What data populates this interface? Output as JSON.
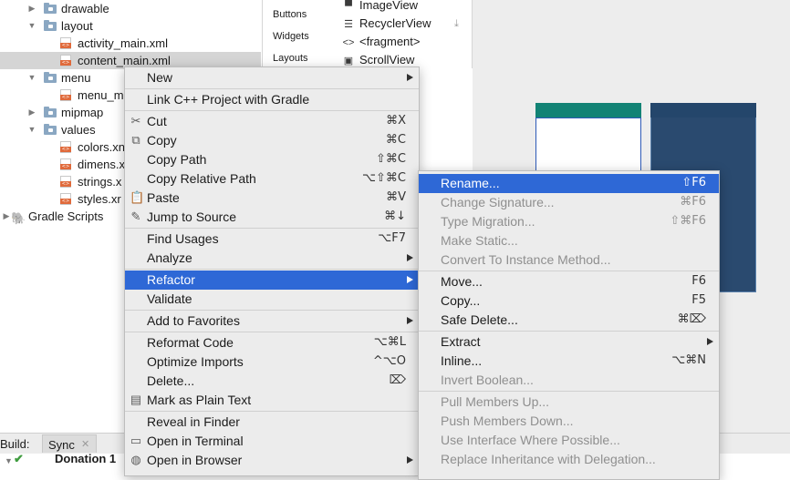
{
  "tree": {
    "items": [
      {
        "label": "drawable",
        "type": "folder",
        "expanded": false
      },
      {
        "label": "layout",
        "type": "folder",
        "expanded": true
      },
      {
        "label": "activity_main.xml",
        "type": "xml"
      },
      {
        "label": "content_main.xml",
        "type": "xml",
        "selected": true
      },
      {
        "label": "menu",
        "type": "folder",
        "expanded": true
      },
      {
        "label": "menu_m",
        "type": "xml"
      },
      {
        "label": "mipmap",
        "type": "folder",
        "expanded": false
      },
      {
        "label": "values",
        "type": "folder",
        "expanded": true
      },
      {
        "label": "colors.xn",
        "type": "xml"
      },
      {
        "label": "dimens.x",
        "type": "xml"
      },
      {
        "label": "strings.x",
        "type": "xml"
      },
      {
        "label": "styles.xr",
        "type": "xml"
      },
      {
        "label": "Gradle Scripts",
        "type": "gradle",
        "expanded": false
      }
    ]
  },
  "palette": {
    "categories": [
      "Buttons",
      "Widgets",
      "Layouts"
    ],
    "items": [
      {
        "label": "ImageView",
        "icon": "image-icon"
      },
      {
        "label": "RecyclerView",
        "icon": "list-icon"
      },
      {
        "label": "<fragment>",
        "icon": "code-icon"
      },
      {
        "label": "ScrollView",
        "icon": "scroll-icon"
      }
    ],
    "download_icon": "download-icon"
  },
  "build": {
    "label": "Build:",
    "tab": "Sync",
    "row_text": "Donation 1"
  },
  "context_menu": {
    "items": [
      {
        "label": "New",
        "submenu": true
      },
      {
        "sep": true
      },
      {
        "label": "Link C++ Project with Gradle"
      },
      {
        "sep": true
      },
      {
        "label": "Cut",
        "icon": "scissors-icon",
        "shortcut": "⌘X"
      },
      {
        "label": "Copy",
        "icon": "copy-icon",
        "shortcut": "⌘C"
      },
      {
        "label": "Copy Path",
        "shortcut": "⇧⌘C"
      },
      {
        "label": "Copy Relative Path",
        "shortcut": "⌥⇧⌘C"
      },
      {
        "label": "Paste",
        "icon": "paste-icon",
        "shortcut": "⌘V"
      },
      {
        "label": "Jump to Source",
        "icon": "pencil-icon",
        "shortcut": "⌘↓"
      },
      {
        "sep": true
      },
      {
        "label": "Find Usages",
        "shortcut": "⌥F7"
      },
      {
        "label": "Analyze",
        "submenu": true
      },
      {
        "sep": true
      },
      {
        "label": "Refactor",
        "submenu": true,
        "highlighted": true
      },
      {
        "label": "Validate"
      },
      {
        "sep": true
      },
      {
        "label": "Add to Favorites",
        "submenu": true
      },
      {
        "sep": true
      },
      {
        "label": "Reformat Code",
        "shortcut": "⌥⌘L"
      },
      {
        "label": "Optimize Imports",
        "shortcut": "^⌥O"
      },
      {
        "label": "Delete...",
        "shortcut": "⌦"
      },
      {
        "label": "Mark as Plain Text",
        "icon": "text-icon"
      },
      {
        "sep": true
      },
      {
        "label": "Reveal in Finder"
      },
      {
        "label": "Open in Terminal",
        "icon": "terminal-icon"
      },
      {
        "label": "Open in Browser",
        "icon": "globe-icon",
        "submenu": true
      }
    ]
  },
  "refactor_menu": {
    "items": [
      {
        "label": "Rename...",
        "shortcut": "⇧F6",
        "highlighted": true
      },
      {
        "label": "Change Signature...",
        "shortcut": "⌘F6",
        "disabled": true
      },
      {
        "label": "Type Migration...",
        "shortcut": "⇧⌘F6",
        "disabled": true
      },
      {
        "label": "Make Static...",
        "disabled": true
      },
      {
        "label": "Convert To Instance Method...",
        "disabled": true
      },
      {
        "sep": true
      },
      {
        "label": "Move...",
        "shortcut": "F6"
      },
      {
        "label": "Copy...",
        "shortcut": "F5"
      },
      {
        "label": "Safe Delete...",
        "shortcut": "⌘⌦"
      },
      {
        "sep": true
      },
      {
        "label": "Extract",
        "submenu": true
      },
      {
        "label": "Inline...",
        "shortcut": "⌥⌘N"
      },
      {
        "label": "Invert Boolean...",
        "disabled": true
      },
      {
        "sep": true
      },
      {
        "label": "Pull Members Up...",
        "disabled": true
      },
      {
        "label": "Push Members Down...",
        "disabled": true
      },
      {
        "label": "Use Interface Where Possible...",
        "disabled": true
      },
      {
        "label": "Replace Inheritance with Delegation...",
        "disabled": true
      }
    ]
  },
  "colors": {
    "highlight": "#2e68d6",
    "menu_bg": "#ececec",
    "device_teal": "#128375",
    "device_blue": "#2a4a6f"
  }
}
